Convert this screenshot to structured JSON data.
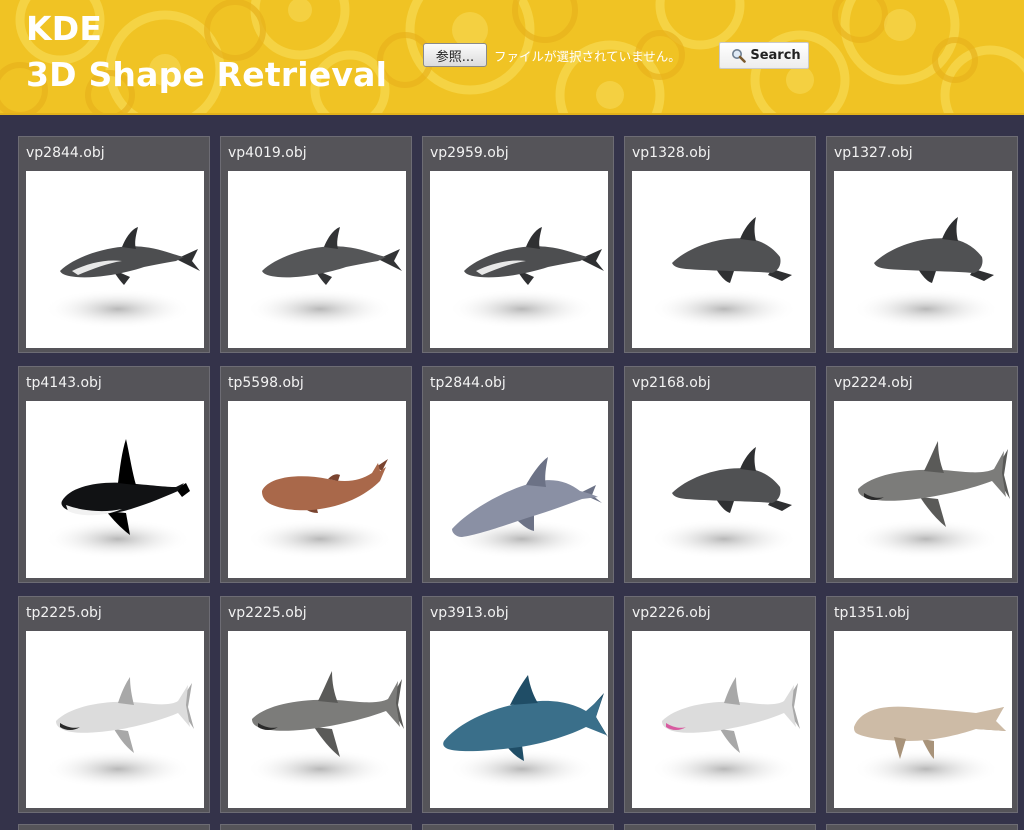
{
  "header": {
    "brand_line1": "KDE",
    "brand_line2": "3D Shape Retrieval",
    "browse_label": "参照...",
    "file_status": "ファイルが選択されていません。",
    "search_label": "Search",
    "search_icon": "magnifier-icon"
  },
  "results": [
    {
      "filename": "vp2844.obj",
      "shape": "dolphin-striped"
    },
    {
      "filename": "vp4019.obj",
      "shape": "dolphin"
    },
    {
      "filename": "vp2959.obj",
      "shape": "dolphin-striped"
    },
    {
      "filename": "vp1328.obj",
      "shape": "dolphin-jumping"
    },
    {
      "filename": "vp1327.obj",
      "shape": "dolphin-jumping"
    },
    {
      "filename": "tp4143.obj",
      "shape": "orca"
    },
    {
      "filename": "tp5598.obj",
      "shape": "sperm-whale"
    },
    {
      "filename": "tp2844.obj",
      "shape": "dolphin-gray"
    },
    {
      "filename": "vp2168.obj",
      "shape": "dolphin-jumping"
    },
    {
      "filename": "vp2224.obj",
      "shape": "shark"
    },
    {
      "filename": "tp2225.obj",
      "shape": "shark-white"
    },
    {
      "filename": "vp2225.obj",
      "shape": "shark"
    },
    {
      "filename": "vp3913.obj",
      "shape": "tuna"
    },
    {
      "filename": "vp2226.obj",
      "shape": "shark-white"
    },
    {
      "filename": "tp1351.obj",
      "shape": "manatee"
    }
  ],
  "colors": {
    "page_background": "#34334a",
    "header_yellow": "#f0c324",
    "card_background": "#555459"
  }
}
